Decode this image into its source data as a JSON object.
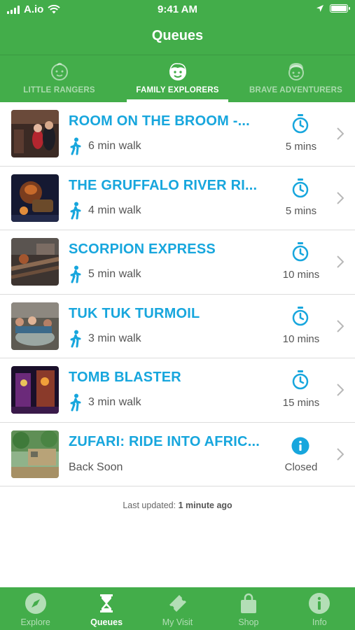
{
  "status_bar": {
    "carrier": "A.io",
    "time": "9:41 AM"
  },
  "header": {
    "title": "Queues"
  },
  "tabs": [
    {
      "label": "LITTLE RANGERS",
      "icon": "child-face-icon",
      "active": false
    },
    {
      "label": "FAMILY EXPLORERS",
      "icon": "family-face-icon",
      "active": true
    },
    {
      "label": "BRAVE ADVENTURERS",
      "icon": "adventurer-face-icon",
      "active": false
    }
  ],
  "rides": [
    {
      "name": "ROOM ON THE BROOM -...",
      "walk": "6 min walk",
      "wait": "5 mins",
      "status_icon": "stopwatch-icon"
    },
    {
      "name": "THE GRUFFALO RIVER RI...",
      "walk": "4 min walk",
      "wait": "5 mins",
      "status_icon": "stopwatch-icon"
    },
    {
      "name": "SCORPION EXPRESS",
      "walk": "5 min walk",
      "wait": "10 mins",
      "status_icon": "stopwatch-icon"
    },
    {
      "name": "TUK TUK TURMOIL",
      "walk": "3 min walk",
      "wait": "10 mins",
      "status_icon": "stopwatch-icon"
    },
    {
      "name": "TOMB BLASTER",
      "walk": "3 min walk",
      "wait": "15 mins",
      "status_icon": "stopwatch-icon"
    },
    {
      "name": "ZUFARI: RIDE INTO AFRIC...",
      "walk": "Back Soon",
      "wait": "Closed",
      "status_icon": "info-icon"
    }
  ],
  "footer": {
    "updated_label": "Last updated:",
    "updated_value": "1 minute ago"
  },
  "bottom_nav": [
    {
      "label": "Explore",
      "icon": "compass-icon",
      "active": false
    },
    {
      "label": "Queues",
      "icon": "hourglass-icon",
      "active": true
    },
    {
      "label": "My Visit",
      "icon": "ticket-icon",
      "active": false
    },
    {
      "label": "Shop",
      "icon": "shopping-bag-icon",
      "active": false
    },
    {
      "label": "Info",
      "icon": "info-circle-icon",
      "active": false
    }
  ],
  "colors": {
    "brand_green": "#43ad4a",
    "link_blue": "#17a6dd",
    "text_grey": "#555555"
  }
}
